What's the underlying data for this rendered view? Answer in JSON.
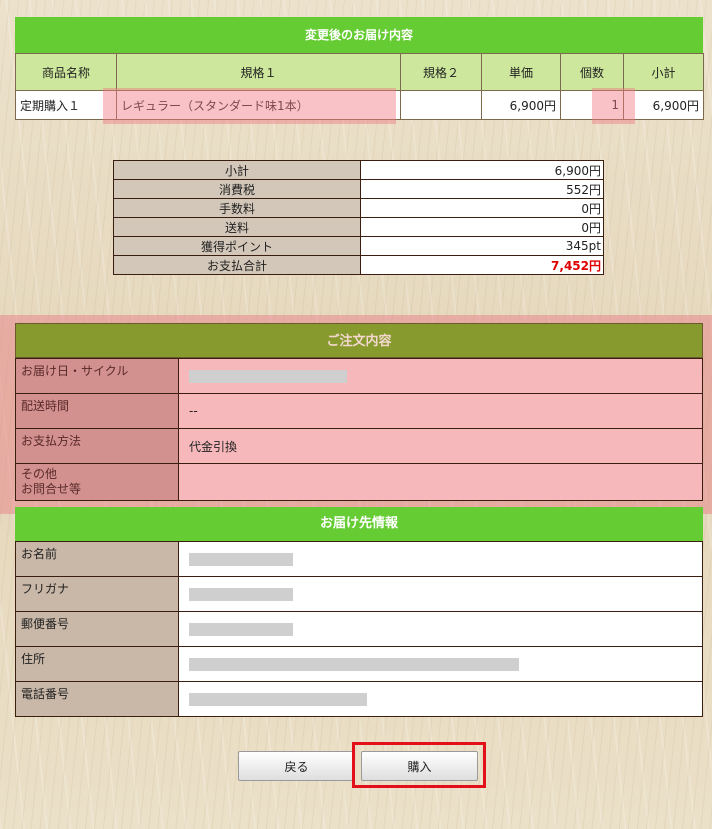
{
  "product_section": {
    "title": "変更後のお届け内容",
    "headers": [
      "商品名称",
      "規格１",
      "規格２",
      "単価",
      "個数",
      "小計"
    ],
    "rows": [
      {
        "name": "定期購入１",
        "spec1": "レギュラー（スタンダード味1本）",
        "spec2": "",
        "unit_price": "6,900円",
        "quantity": "1",
        "subtotal": "6,900円"
      }
    ]
  },
  "totals": {
    "rows": [
      {
        "label": "小計",
        "value": "6,900円"
      },
      {
        "label": "消費税",
        "value": "552円"
      },
      {
        "label": "手数料",
        "value": "0円"
      },
      {
        "label": "送料",
        "value": "0円"
      },
      {
        "label": "獲得ポイント",
        "value": "345pt"
      },
      {
        "label": "お支払合計",
        "value": "7,452円"
      }
    ]
  },
  "order_section": {
    "title": "ご注文内容",
    "rows": [
      {
        "label": "お届け日・サイクル",
        "value": ""
      },
      {
        "label": "配送時間",
        "value": "--"
      },
      {
        "label": "お支払方法",
        "value": "代金引換"
      },
      {
        "label": "その他\nお問合せ等",
        "value": ""
      }
    ]
  },
  "shipping_section": {
    "title": "お届け先情報",
    "rows": [
      {
        "label": "お名前",
        "value": ""
      },
      {
        "label": "フリガナ",
        "value": ""
      },
      {
        "label": "郵便番号",
        "value": ""
      },
      {
        "label": "住所",
        "value": ""
      },
      {
        "label": "電話番号",
        "value": ""
      }
    ]
  },
  "buttons": {
    "back": "戻る",
    "purchase": "購入"
  },
  "colors": {
    "section_green": "#66cc33",
    "section_olive": "#869a2e",
    "total_red": "#e00000",
    "highlight_pink": "#f0a0a8",
    "callout_red": "#e3101a"
  }
}
